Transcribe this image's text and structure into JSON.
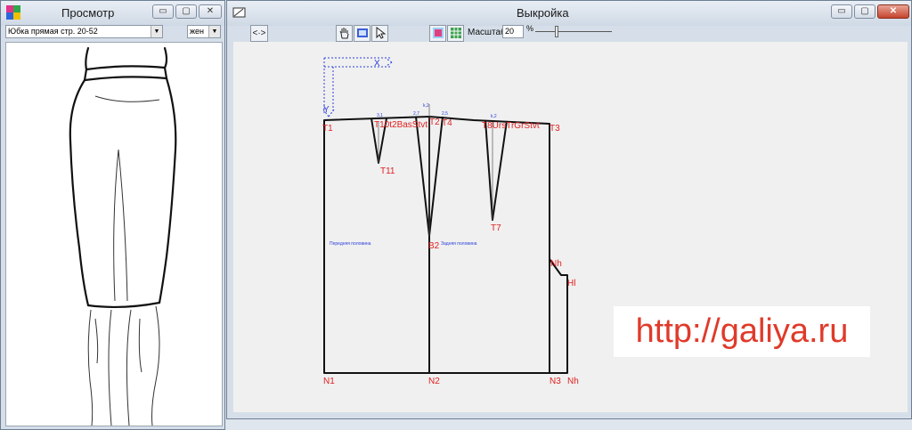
{
  "preview_window": {
    "title": "Просмотр",
    "model_select": "Юбка прямая стр. 20-52",
    "gender_select": "жен"
  },
  "pattern_window": {
    "title": "Выкройка",
    "toolbar": {
      "nav_button": "<·>",
      "scale_label": "Масштаб",
      "scale_value": "20",
      "scale_unit": "%"
    },
    "labels": {
      "T1": "T1",
      "T2": "T2",
      "T3": "T3",
      "T4": "T4",
      "T7": "T7",
      "T11": "T11",
      "B2": "B2",
      "N1": "N1",
      "N2": "N2",
      "N3": "N3",
      "Nh": "Nh",
      "Hl": "Hl",
      "Nh_side": "Nh",
      "front_dart_group": "T10t2BasStvt",
      "back_dart_group": "T8UrsTrGrStvt",
      "front_half": "Передняя половина",
      "back_half": "Задняя половина",
      "x_axis": "X",
      "y_axis": "Y"
    },
    "small_labels": {
      "a": "3,1",
      "b": "2,7",
      "c": "k,2",
      "d": "2,5",
      "e": "k,2"
    }
  },
  "watermark": "http://galiya.ru",
  "colors": {
    "pattern_line": "#111111",
    "point_label": "#e02020",
    "annotation": "#2a3fdc"
  }
}
